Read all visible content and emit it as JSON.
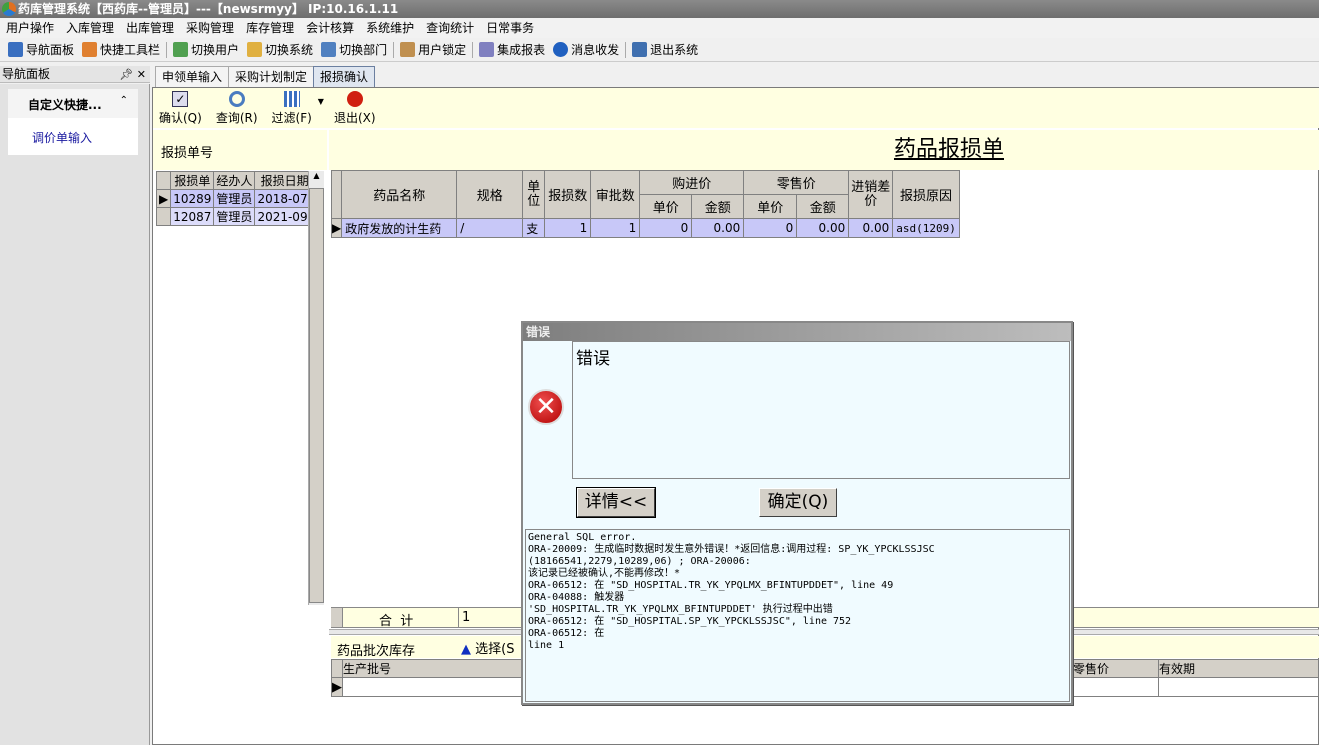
{
  "window": {
    "title": "药库管理系统【西药库--管理员】---【newsrmyy】 IP:10.16.1.11"
  },
  "menu": [
    "用户操作",
    "入库管理",
    "出库管理",
    "采购管理",
    "库存管理",
    "会计核算",
    "系统维护",
    "查询统计",
    "日常事务"
  ],
  "toolbar": [
    "导航面板",
    "快捷工具栏",
    "切换用户",
    "切换系统",
    "切换部门",
    "用户锁定",
    "集成报表",
    "消息收发",
    "退出系统"
  ],
  "nav": {
    "title": "导航面板",
    "group": "自定义快捷...",
    "items": [
      "调价单输入"
    ]
  },
  "tabs": [
    "申领单输入",
    "采购计划制定",
    "报损确认"
  ],
  "actions": {
    "confirm": "确认(Q)",
    "query": "查询(R)",
    "filter": "过滤(F)",
    "exit": "退出(X)"
  },
  "left": {
    "label": "报损单号",
    "headers": [
      "报损单",
      "经办人",
      "报损日期"
    ],
    "rows": [
      [
        "10289",
        "管理员",
        "2018-07-"
      ],
      [
        "12087",
        "管理员",
        "2021-09-"
      ]
    ]
  },
  "form": {
    "title": "药品报损单"
  },
  "main": {
    "headers": {
      "name": "药品名称",
      "spec": "规格",
      "unit": "单位",
      "qty": "报损数",
      "approved": "审批数",
      "purchase": "购进价",
      "retail": "零售价",
      "unit_price": "单价",
      "amount": "金额",
      "diff": "进销差价",
      "reason": "报损原因"
    },
    "rows": [
      {
        "name": "政府发放的计生药",
        "spec": "/",
        "unit": "支",
        "qty": "1",
        "approved": "1",
        "pp": "0",
        "pa": "0.00",
        "rp": "0",
        "ra": "0.00",
        "diff": "0.00",
        "reason": "asd(1209)"
      }
    ],
    "total_label": "合  计",
    "total_value": "1"
  },
  "lower": {
    "title": "药品批次库存",
    "select": "选择(S",
    "headers": [
      "生产批号",
      "零售价",
      "有效期"
    ]
  },
  "dialog": {
    "title": "错误",
    "message": "错误",
    "details_button": "详情<<",
    "ok_button": "确定(Q)",
    "details": "General SQL error.\nORA-20009: 生成临时数据时发生意外错误！*返回信息:调用过程: SP_YK_YPCKLSSJSC\n(18166541,2279,10289,06) ; ORA-20006:\n该记录已经被确认,不能再修改！*\nORA-06512: 在 \"SD_HOSPITAL.TR_YK_YPQLMX_BFINTUPDDET\", line 49\nORA-04088: 触发器\n'SD_HOSPITAL.TR_YK_YPQLMX_BFINTUPDDET' 执行过程中出错\nORA-06512: 在 \"SD_HOSPITAL.SP_YK_YPCKLSSJSC\", line 752\nORA-06512: 在\nline 1"
  }
}
